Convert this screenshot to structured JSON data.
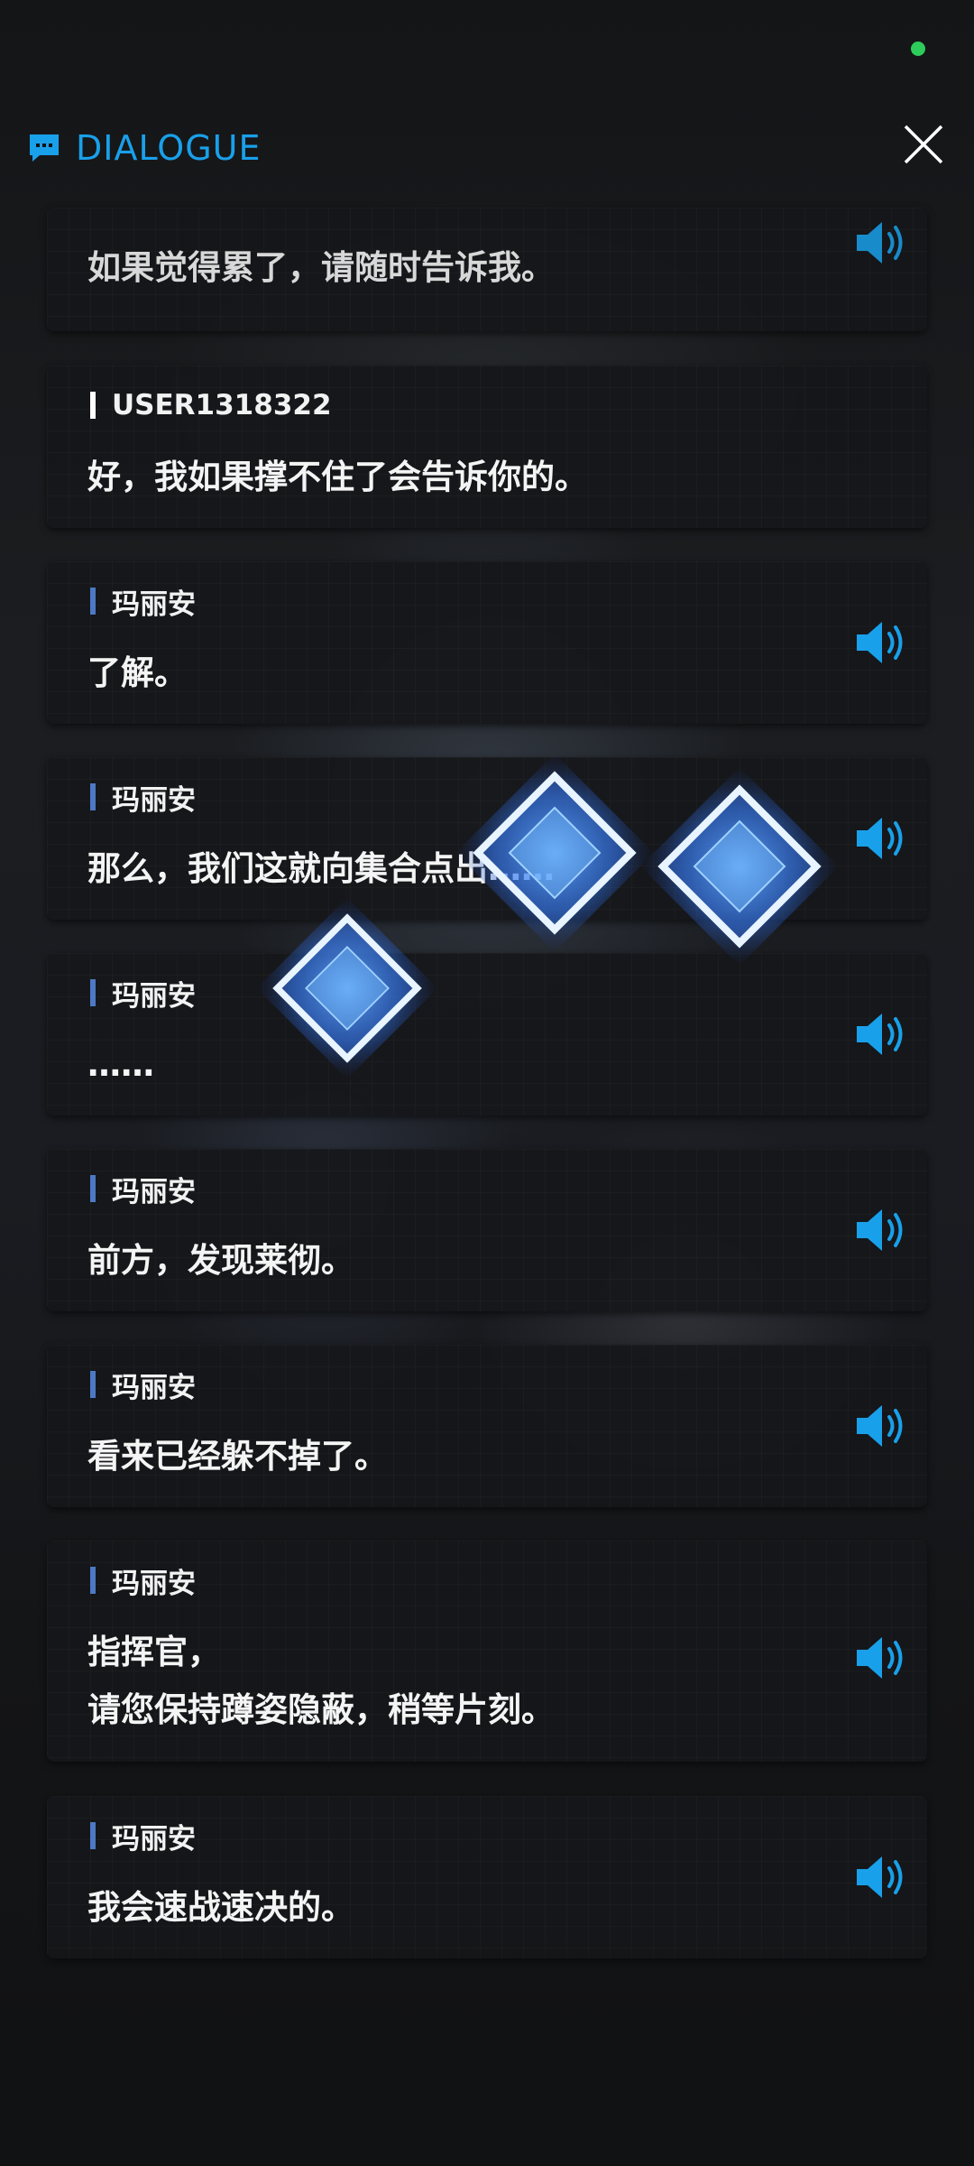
{
  "header": {
    "title": "DIALOGUE",
    "accent_color": "#19a0ea",
    "icon": "chat-bubble-icon",
    "close_icon": "close-icon"
  },
  "status_indicator_color": "#2ecc5a",
  "dialogue": [
    {
      "speaker": "",
      "text": "如果觉得累了，请随时告诉我。",
      "voice": true,
      "is_user": false
    },
    {
      "speaker": "USER1318322",
      "text": "好，我如果撑不住了会告诉你的。",
      "voice": false,
      "is_user": true
    },
    {
      "speaker": "玛丽安",
      "text": "了解。",
      "voice": true,
      "is_user": false
    },
    {
      "speaker": "玛丽安",
      "text": "那么，我们这就向集合点出……",
      "voice": true,
      "is_user": false
    },
    {
      "speaker": "玛丽安",
      "text": "……",
      "voice": true,
      "is_user": false
    },
    {
      "speaker": "玛丽安",
      "text": "前方，发现莱彻。",
      "voice": true,
      "is_user": false
    },
    {
      "speaker": "玛丽安",
      "text": "看来已经躲不掉了。",
      "voice": true,
      "is_user": false
    },
    {
      "speaker": "玛丽安",
      "text": "指挥官，\n请您保持蹲姿隐蔽，稍等片刻。",
      "voice": true,
      "is_user": false
    },
    {
      "speaker": "玛丽安",
      "text": "我会速战速决的。",
      "voice": true,
      "is_user": false
    }
  ],
  "voice_icon": "speaker-volume-icon",
  "speaker_bar_color": "#4d79c4"
}
